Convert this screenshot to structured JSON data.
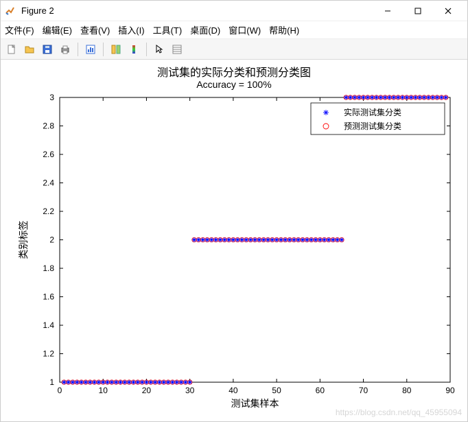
{
  "window": {
    "title": "Figure 2"
  },
  "menu": {
    "file": "文件(F)",
    "edit": "编辑(E)",
    "view": "查看(V)",
    "insert": "插入(I)",
    "tools": "工具(T)",
    "desktop": "桌面(D)",
    "window": "窗口(W)",
    "help": "帮助(H)"
  },
  "toolbar_icons": {
    "new": "new-figure-icon",
    "open": "open-icon",
    "save": "save-icon",
    "print": "print-icon",
    "edit_plot": "edit-plot-icon",
    "zoom_in": "zoom-in-icon",
    "insert_legend": "legend-icon",
    "cursor": "cursor-icon",
    "data_cursor": "data-cursor-icon"
  },
  "chart_data": {
    "type": "scatter",
    "title": "测试集的实际分类和预测分类图",
    "subtitle": "Accuracy = 100%",
    "xlabel": "测试集样本",
    "ylabel": "类别标签",
    "xlim": [
      0,
      90
    ],
    "ylim": [
      1,
      3
    ],
    "xticks": [
      0,
      10,
      20,
      30,
      40,
      50,
      60,
      70,
      80,
      90
    ],
    "yticks": [
      1,
      1.2,
      1.4,
      1.6,
      1.8,
      2,
      2.2,
      2.4,
      2.6,
      2.8,
      3
    ],
    "series": [
      {
        "name": "实际测试集分类",
        "marker": "asterisk",
        "color": "#0000ff",
        "x": [
          1,
          2,
          3,
          4,
          5,
          6,
          7,
          8,
          9,
          10,
          11,
          12,
          13,
          14,
          15,
          16,
          17,
          18,
          19,
          20,
          21,
          22,
          23,
          24,
          25,
          26,
          27,
          28,
          29,
          30,
          31,
          32,
          33,
          34,
          35,
          36,
          37,
          38,
          39,
          40,
          41,
          42,
          43,
          44,
          45,
          46,
          47,
          48,
          49,
          50,
          51,
          52,
          53,
          54,
          55,
          56,
          57,
          58,
          59,
          60,
          61,
          62,
          63,
          64,
          65,
          66,
          67,
          68,
          69,
          70,
          71,
          72,
          73,
          74,
          75,
          76,
          77,
          78,
          79,
          80,
          81,
          82,
          83,
          84,
          85,
          86,
          87,
          88,
          89
        ],
        "y": [
          1,
          1,
          1,
          1,
          1,
          1,
          1,
          1,
          1,
          1,
          1,
          1,
          1,
          1,
          1,
          1,
          1,
          1,
          1,
          1,
          1,
          1,
          1,
          1,
          1,
          1,
          1,
          1,
          1,
          1,
          2,
          2,
          2,
          2,
          2,
          2,
          2,
          2,
          2,
          2,
          2,
          2,
          2,
          2,
          2,
          2,
          2,
          2,
          2,
          2,
          2,
          2,
          2,
          2,
          2,
          2,
          2,
          2,
          2,
          2,
          2,
          2,
          2,
          2,
          2,
          3,
          3,
          3,
          3,
          3,
          3,
          3,
          3,
          3,
          3,
          3,
          3,
          3,
          3,
          3,
          3,
          3,
          3,
          3,
          3,
          3,
          3,
          3,
          3
        ]
      },
      {
        "name": "预测测试集分类",
        "marker": "circle",
        "color": "#ff0000",
        "x": [
          1,
          2,
          3,
          4,
          5,
          6,
          7,
          8,
          9,
          10,
          11,
          12,
          13,
          14,
          15,
          16,
          17,
          18,
          19,
          20,
          21,
          22,
          23,
          24,
          25,
          26,
          27,
          28,
          29,
          30,
          31,
          32,
          33,
          34,
          35,
          36,
          37,
          38,
          39,
          40,
          41,
          42,
          43,
          44,
          45,
          46,
          47,
          48,
          49,
          50,
          51,
          52,
          53,
          54,
          55,
          56,
          57,
          58,
          59,
          60,
          61,
          62,
          63,
          64,
          65,
          66,
          67,
          68,
          69,
          70,
          71,
          72,
          73,
          74,
          75,
          76,
          77,
          78,
          79,
          80,
          81,
          82,
          83,
          84,
          85,
          86,
          87,
          88,
          89
        ],
        "y": [
          1,
          1,
          1,
          1,
          1,
          1,
          1,
          1,
          1,
          1,
          1,
          1,
          1,
          1,
          1,
          1,
          1,
          1,
          1,
          1,
          1,
          1,
          1,
          1,
          1,
          1,
          1,
          1,
          1,
          1,
          2,
          2,
          2,
          2,
          2,
          2,
          2,
          2,
          2,
          2,
          2,
          2,
          2,
          2,
          2,
          2,
          2,
          2,
          2,
          2,
          2,
          2,
          2,
          2,
          2,
          2,
          2,
          2,
          2,
          2,
          2,
          2,
          2,
          2,
          2,
          3,
          3,
          3,
          3,
          3,
          3,
          3,
          3,
          3,
          3,
          3,
          3,
          3,
          3,
          3,
          3,
          3,
          3,
          3,
          3,
          3,
          3,
          3,
          3
        ]
      }
    ],
    "legend": {
      "position": "northeast-inside"
    }
  },
  "watermark": "https://blog.csdn.net/qq_45955094"
}
